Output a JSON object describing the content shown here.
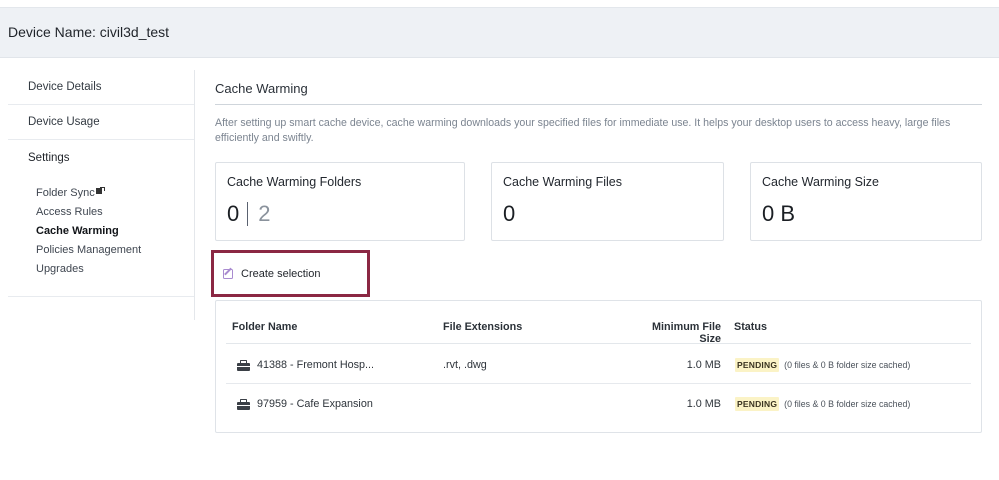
{
  "header": {
    "title": "Device Name: civil3d_test"
  },
  "sidebar": {
    "items": [
      {
        "label": "Device Details"
      },
      {
        "label": "Device Usage"
      }
    ],
    "settings_heading": "Settings",
    "sub_items": [
      {
        "label": "Folder Sync",
        "icon": "external-link-icon"
      },
      {
        "label": "Access Rules"
      },
      {
        "label": "Cache Warming",
        "active": true
      },
      {
        "label": "Policies Management"
      },
      {
        "label": "Upgrades"
      }
    ]
  },
  "main": {
    "title": "Cache Warming",
    "description": "After setting up smart cache device, cache warming downloads your specified files for immediate use. It helps your desktop users to access heavy, large files efficiently and swiftly.",
    "cards": {
      "folders": {
        "label": "Cache Warming Folders",
        "value": "0",
        "total": "2"
      },
      "files": {
        "label": "Cache Warming Files",
        "value": "0"
      },
      "size": {
        "label": "Cache Warming Size",
        "value": "0 B"
      }
    },
    "create_button": {
      "label": "Create selection",
      "icon": "edit-icon",
      "highlight_color": "#8b2743"
    },
    "table": {
      "headers": {
        "name": "Folder Name",
        "ext": "File Extensions",
        "min": "Minimum File Size",
        "status": "Status"
      },
      "rows": [
        {
          "name": "41388 - Fremont Hosp...",
          "ext": ".rvt, .dwg",
          "min": "1.0 MB",
          "status": "PENDING",
          "note": "(0 files & 0 B folder size cached)"
        },
        {
          "name": "97959 - Cafe Expansion",
          "ext": "",
          "min": "1.0 MB",
          "status": "PENDING",
          "note": "(0 files & 0 B folder size cached)"
        }
      ]
    }
  }
}
